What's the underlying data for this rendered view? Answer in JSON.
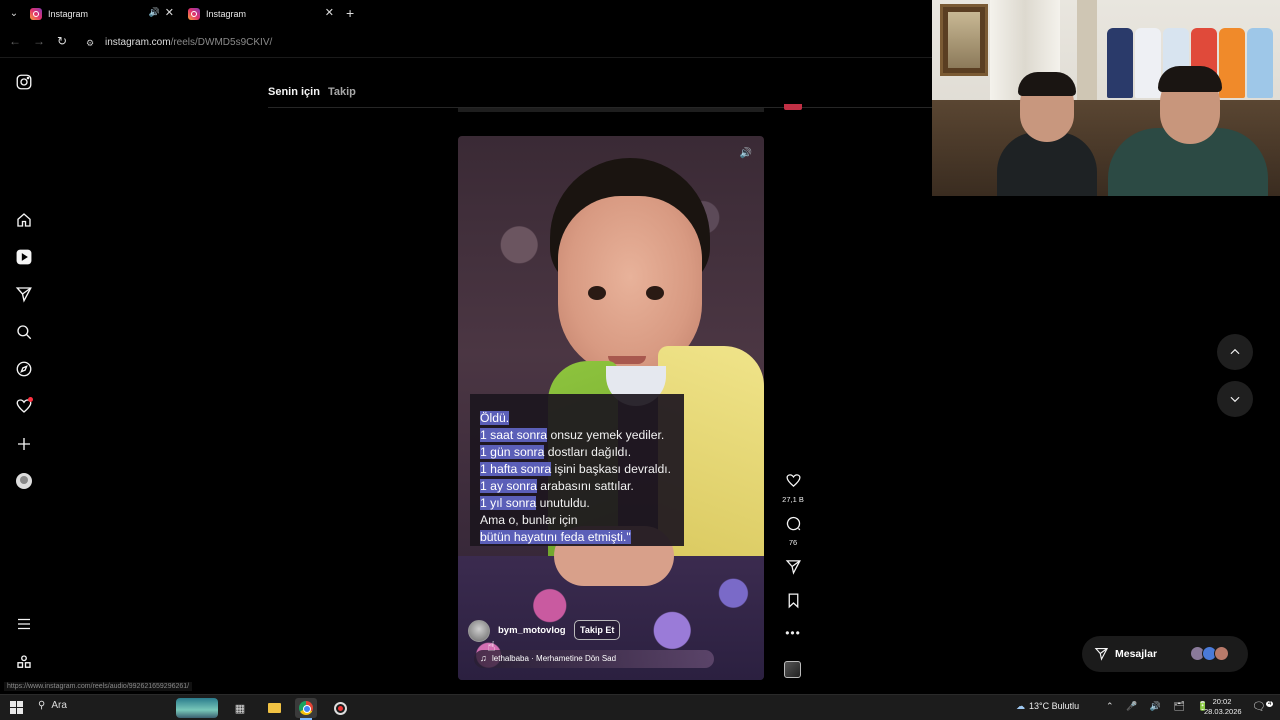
{
  "browser": {
    "tabs": [
      {
        "title": "Instagram",
        "audio": true
      },
      {
        "title": "Instagram",
        "audio": false
      }
    ],
    "url_host": "instagram.com",
    "url_path": "/reels/DWMD5s9CKIV/",
    "status_link": "https://www.instagram.com/reels/audio/992621659296261/"
  },
  "feed_tabs": {
    "active": "Senin için",
    "inactive": "Takip"
  },
  "reel": {
    "caption_lines": [
      {
        "hl": "Öldü.",
        "rest": ""
      },
      {
        "hl": "1 saat sonra",
        "rest": " onsuz yemek yediler."
      },
      {
        "hl": "1 gün sonra",
        "rest": " dostları dağıldı."
      },
      {
        "hl": "1 hafta sonra",
        "rest": " işini başkası devraldı."
      },
      {
        "hl": "1 ay sonra",
        "rest": " arabasını sattılar."
      },
      {
        "hl": "1 yıl sonra",
        "rest": " unutuldu."
      },
      {
        "hl": "",
        "rest": "Ama o, bunlar için"
      },
      {
        "hl": "bütün hayatını feda etmişti.\"",
        "rest": ""
      }
    ],
    "author": "bym_motovlog",
    "follow_label": "Takip Et",
    "audio": "lethalbaba · Merhametine Dön Sad"
  },
  "actions": {
    "likes": "27,1 B",
    "comments": "76"
  },
  "messages": {
    "label": "Mesajlar"
  },
  "taskbar": {
    "search": "Ara",
    "weather": "13°C  Bulutlu",
    "time": "20:02",
    "date": "28.03.2026",
    "notif_count": "4"
  },
  "colors": {
    "highlight": "#5b5fb8",
    "notification_red": "#ff3040",
    "accent_blue": "#7ab7ff"
  }
}
